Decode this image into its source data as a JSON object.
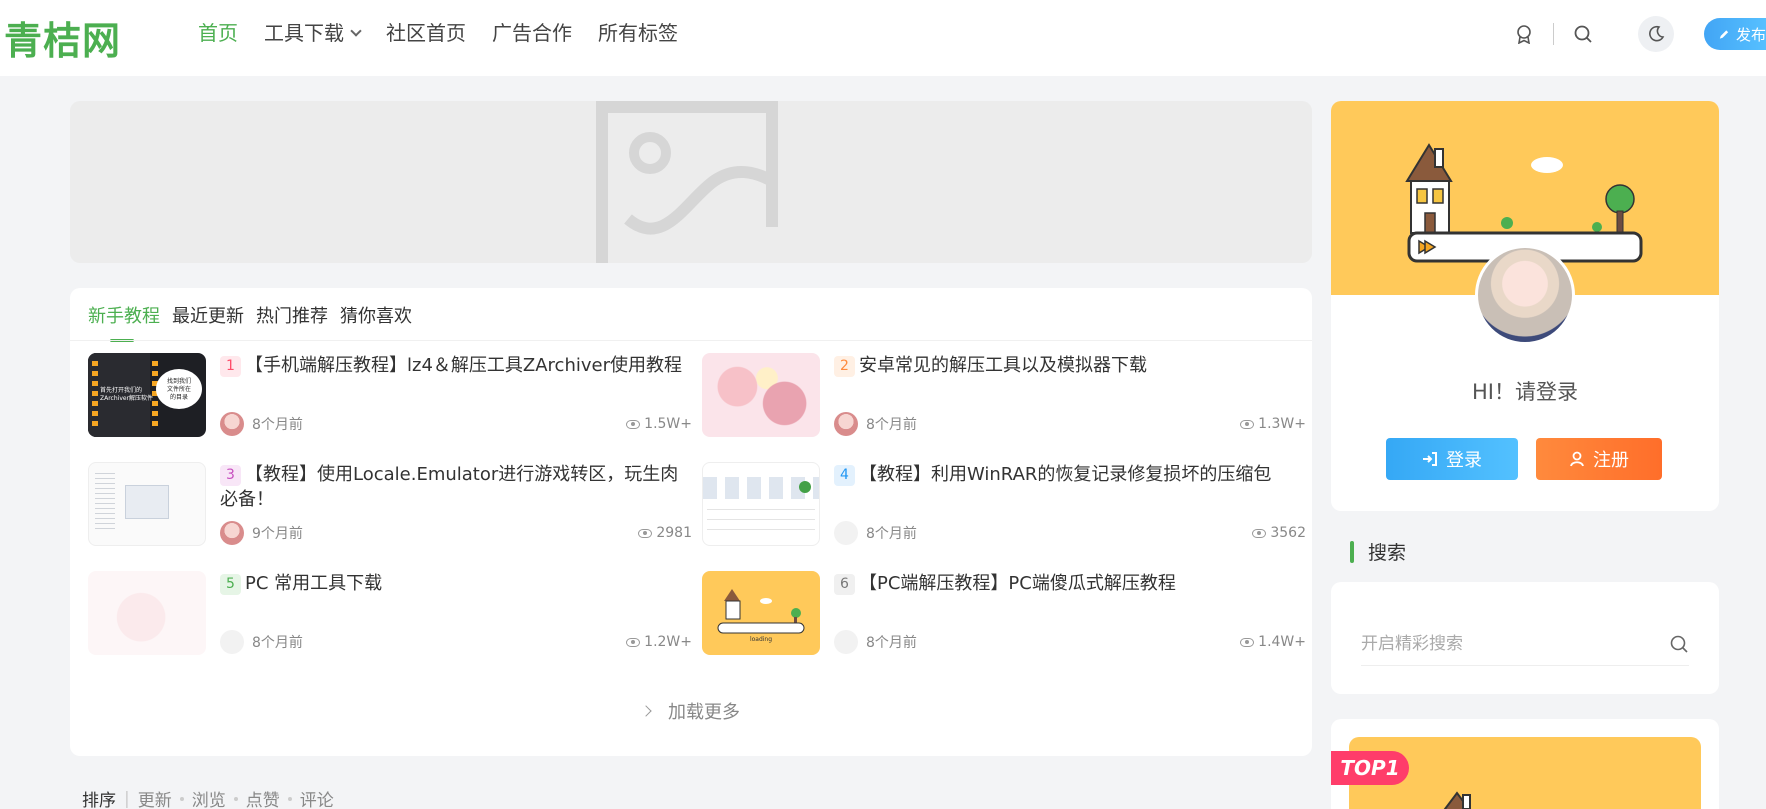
{
  "header": {
    "logo_text": "青桔网",
    "nav": [
      {
        "label": "首页",
        "active": true
      },
      {
        "label": "工具下载",
        "has_dropdown": true
      },
      {
        "label": "社区首页"
      },
      {
        "label": "广告合作"
      },
      {
        "label": "所有标签"
      }
    ],
    "publish_label": "发布"
  },
  "tabs": [
    "新手教程",
    "最近更新",
    "热门推荐",
    "猜你喜欢"
  ],
  "posts": [
    {
      "rank": "1",
      "title": "【手机端解压教程】lz4＆解压工具ZArchiver使用教程",
      "time": "8个月前",
      "views": "1.5W+",
      "rank_color": "#ff4d6a",
      "rank_bg": "#ffe8ec"
    },
    {
      "rank": "2",
      "title": "安卓常见的解压工具以及模拟器下载",
      "time": "8个月前",
      "views": "1.3W+",
      "rank_color": "#ff8a3d",
      "rank_bg": "#fff0e4"
    },
    {
      "rank": "3",
      "title": "【教程】使用Locale.Emulator进行游戏转区，玩生肉必备！",
      "time": "9个月前",
      "views": "2981",
      "rank_color": "#c850c0",
      "rank_bg": "#f8e6f7"
    },
    {
      "rank": "4",
      "title": "【教程】利用WinRAR的恢复记录修复损坏的压缩包",
      "time": "8个月前",
      "views": "3562",
      "rank_color": "#2196f3",
      "rank_bg": "#e3f1fd"
    },
    {
      "rank": "5",
      "title": "PC 常用工具下载",
      "time": "8个月前",
      "views": "1.2W+",
      "rank_color": "#4caf50",
      "rank_bg": "#e6f5e6"
    },
    {
      "rank": "6",
      "title": "【PC端解压教程】PC端傻瓜式解压教程",
      "time": "8个月前",
      "views": "1.4W+",
      "rank_color": "#777777",
      "rank_bg": "#f0f0f0"
    }
  ],
  "thumb_texts": {
    "t1": "找到我们\n文件所在\n的目录",
    "t1_left": "首先打开我们的\nZArchiver解压软件",
    "t6": "loading"
  },
  "load_more": "加载更多",
  "sort": {
    "label": "排序",
    "options": [
      "更新",
      "浏览",
      "点赞",
      "评论"
    ]
  },
  "user": {
    "greeting": "HI！请登录",
    "login": "登录",
    "register": "注册"
  },
  "search": {
    "title": "搜索",
    "placeholder": "开启精彩搜索"
  },
  "top_badge": "TOP1",
  "colors": {
    "accent": "#4caf50",
    "login": "#35a8f5",
    "register": "#ff7a33",
    "banner_yellow": "#ffc95a"
  }
}
